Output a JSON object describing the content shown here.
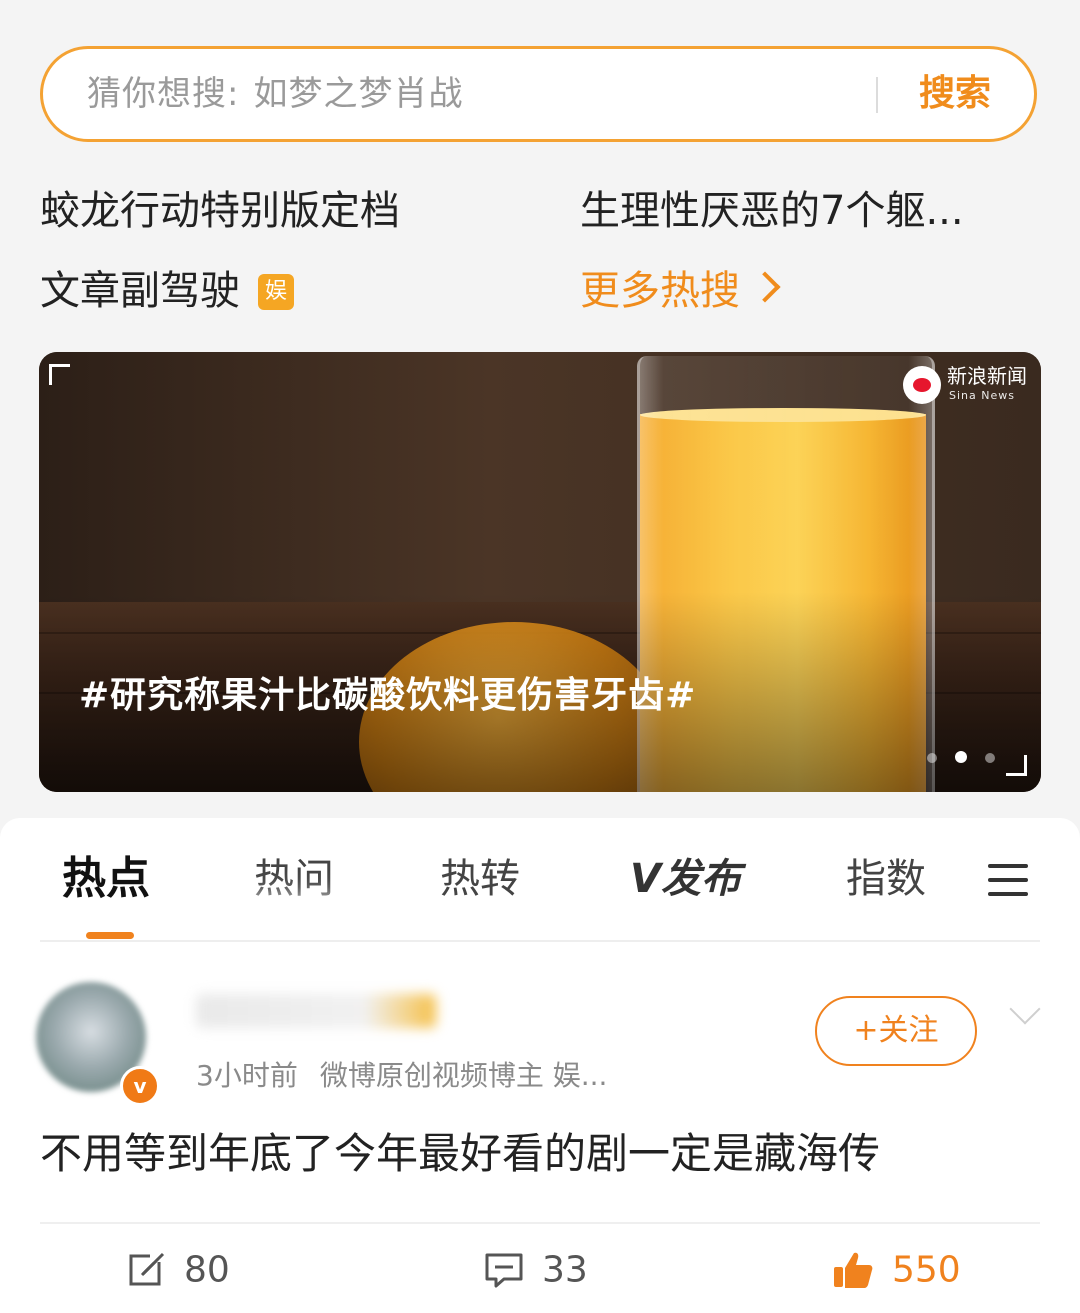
{
  "search": {
    "prompt": "猜你想搜:",
    "term": "如梦之梦肖战",
    "button": "搜索"
  },
  "hot": {
    "items": [
      "蛟龙行动特别版定档",
      "生理性厌恶的7个躯...",
      "文章副驾驶"
    ],
    "badge": "娱",
    "more": "更多热搜"
  },
  "banner": {
    "source_name": "新浪新闻",
    "source_sub": "Sina News",
    "title": "#研究称果汁比碳酸饮料更伤害牙齿#",
    "dots_total": 3,
    "dots_active": 2
  },
  "tabs": [
    "热点",
    "热问",
    "热转",
    "发布",
    "指数"
  ],
  "post": {
    "meta_time": "3小时前",
    "meta_info": "微博原创视频博主 娱...",
    "follow": "+关注",
    "text": "不用等到年底了今年最好看的剧一定是藏海传",
    "repost_count": "80",
    "comment_count": "33",
    "like_count": "550"
  },
  "colors": {
    "accent": "#f0821e",
    "search_border": "#f4a233",
    "badge": "#f5a623"
  }
}
